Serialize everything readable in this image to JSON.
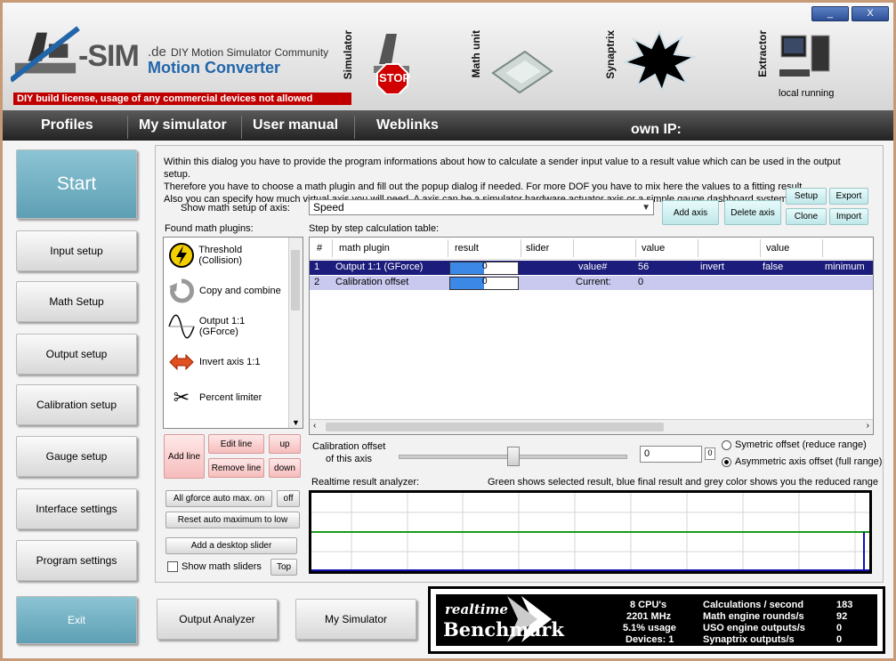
{
  "window": {
    "minimize_label": "_",
    "close_label": "X"
  },
  "header": {
    "logo_sim": "-SIM",
    "logo_de": ".de",
    "logo_tagline": "DIY Motion Simulator Community",
    "logo_product": "Motion Converter",
    "license_text": "DIY build license, usage of any commercial devices not allowed",
    "modules": {
      "simulator_label": "Simulator",
      "stop_label": "STOP",
      "math_unit_label": "Math unit",
      "synaptrix_label": "Synaptrix",
      "extractor_label": "Extractor",
      "extractor_status": "local running"
    }
  },
  "menu": {
    "items": [
      "Profiles",
      "My simulator",
      "User manual",
      "Weblinks"
    ],
    "own_ip_label": "own IP:"
  },
  "nav": {
    "start": "Start",
    "input_setup": "Input setup",
    "math_setup": "Math Setup",
    "output_setup": "Output setup",
    "calibration_setup": "Calibration setup",
    "gauge_setup": "Gauge setup",
    "interface_settings": "Interface settings",
    "program_settings": "Program settings",
    "exit": "Exit"
  },
  "bottom_buttons": {
    "output_analyzer": "Output Analyzer",
    "my_simulator": "My Simulator"
  },
  "main": {
    "info_line1": "Within this dialog you have to provide the program informations about how to calculate a sender input value to a result value which can be used in the output setup.",
    "info_line2": "Therefore you have to choose a math plugin and fill out the popup dialog if needed. For more DOF you have to mix here the values to a fitting result.",
    "info_line3": "Also you can specify how much virtual axis you will need. A axis can be a simulator hardware actuator axis or a simple gauge dashboard system.",
    "show_axis_label": "Show math setup of axis:",
    "axis_value": "Speed",
    "add_axis": "Add axis",
    "delete_axis": "Delete axis",
    "setup": "Setup",
    "export": "Export",
    "clone": "Clone",
    "import": "Import",
    "found_plugins_label": "Found math plugins:",
    "step_table_label": "Step by step calculation table:",
    "plugins": [
      {
        "name": "Threshold (Collision)",
        "icon": "lightning-icon"
      },
      {
        "name": "Copy and combine",
        "icon": "circular-arrow-icon"
      },
      {
        "name": "Output 1:1 (GForce)",
        "icon": "sine-wave-icon"
      },
      {
        "name": "Invert axis 1:1",
        "icon": "invert-arrows-icon"
      },
      {
        "name": "Percent limiter",
        "icon": "scissors-icon"
      }
    ],
    "table": {
      "headers": [
        "#",
        "math plugin",
        "result",
        "slider",
        "",
        "value",
        "",
        "value"
      ],
      "rows": [
        {
          "num": "1",
          "plugin": "Output 1:1 (GForce)",
          "result": "0",
          "c4": "value#",
          "c5": "56",
          "c6": "invert",
          "c7": "false",
          "c8": "minimum",
          "result_fraction": 0.5
        },
        {
          "num": "2",
          "plugin": "Calibration offset",
          "result": "0",
          "c4": "Current:",
          "c5": "0",
          "c6": "",
          "c7": "",
          "c8": "",
          "result_fraction": 0.5
        }
      ]
    },
    "line_buttons": {
      "add_line": "Add line",
      "edit_line": "Edit line",
      "remove_line": "Remove line",
      "up": "up",
      "down": "down"
    },
    "gforce_auto": "All gforce auto max. on",
    "gforce_off": "off",
    "reset_auto": "Reset auto maximum to low",
    "add_desktop_slider": "Add a desktop slider",
    "show_math_sliders": "Show math sliders",
    "top": "Top",
    "calibration_label1": "Calibration offset",
    "calibration_label2": "of this axis",
    "calibration_value": "0",
    "calibration_unit": "0",
    "calibration_slider_fraction": 0.5,
    "radio_symmetric": "Symetric offset (reduce range)",
    "radio_asymmetric": "Asymmetric axis offset (full range)",
    "analyzer_label": "Realtime result analyzer:",
    "analyzer_hint": "Green shows selected result, blue final result and grey color shows you the reduced range"
  },
  "benchmark": {
    "logo_line1": "realtime",
    "logo_line2": "Benchmark",
    "cpus": "8 CPU's",
    "mhz": "2201 MHz",
    "usage": "5.1% usage",
    "devices": "Devices: 1",
    "labels": [
      "Calculations / second",
      "Math engine rounds/s",
      "USO engine outputs/s",
      "Synaptrix outputs/s"
    ],
    "values": [
      "183",
      "92",
      "0",
      "0"
    ]
  },
  "colors": {
    "accent": "#5e9fb4",
    "license_red": "#c00000",
    "selection": "#1c1c7c",
    "graph_green": "#1a9a1a",
    "graph_blue": "#1010b0"
  }
}
